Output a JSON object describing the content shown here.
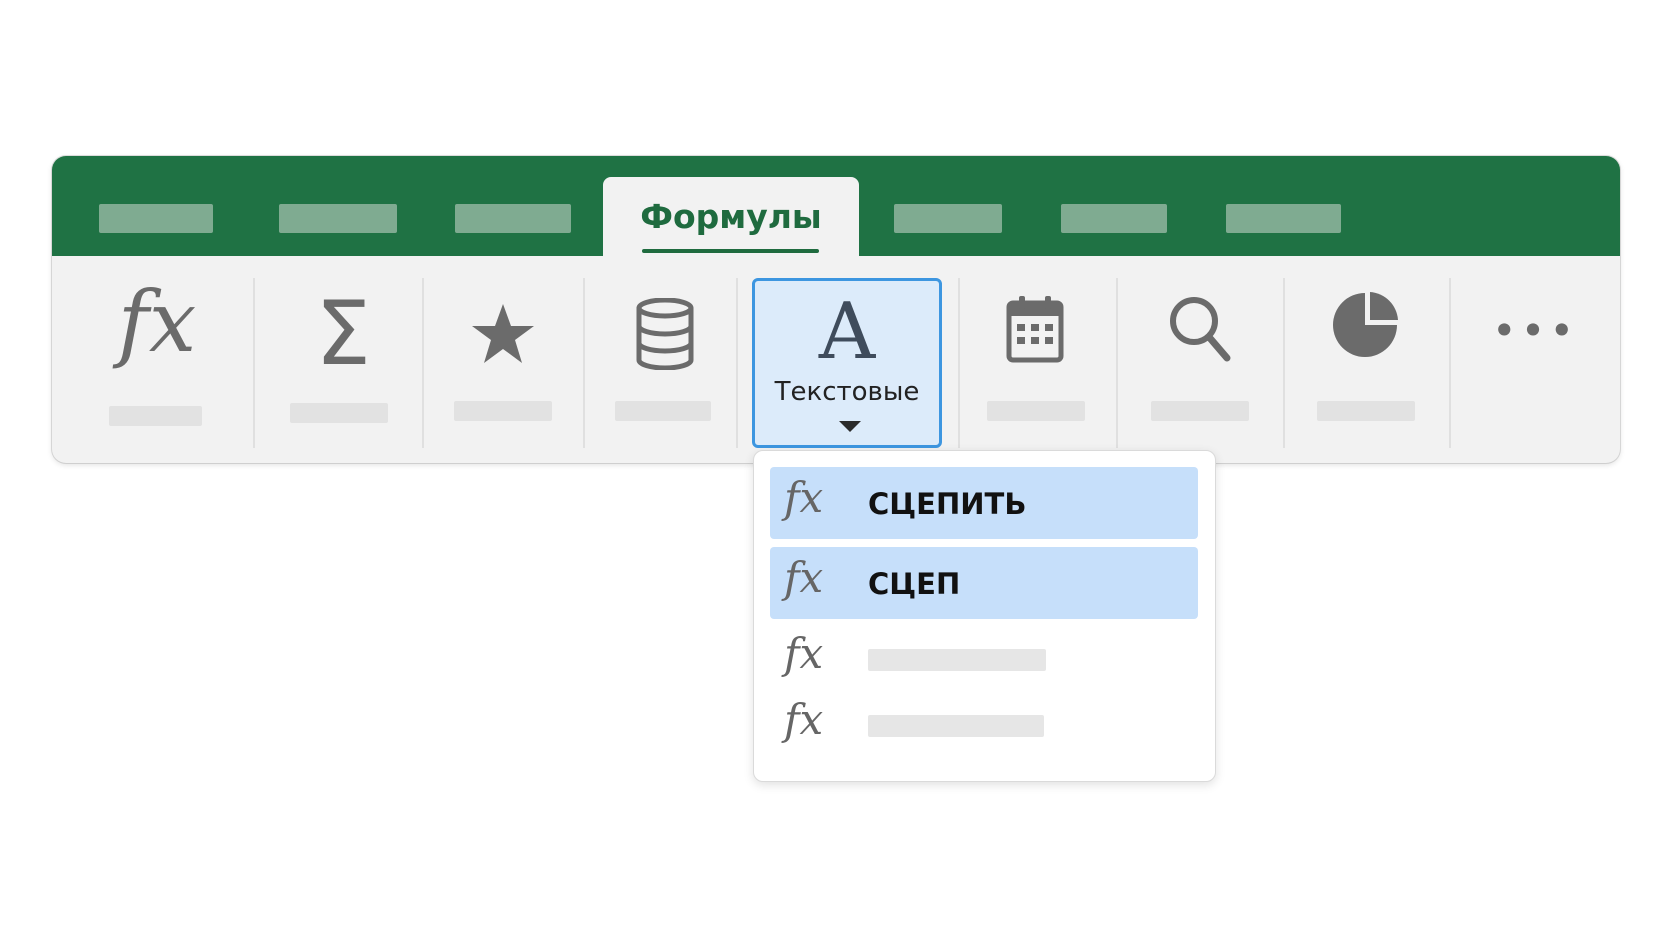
{
  "ribbon": {
    "active_tab": "Формулы",
    "groups": {
      "text": {
        "label": "Текстовые",
        "icon": "letter-a-icon"
      }
    },
    "icons": [
      "fx-icon",
      "sigma-icon",
      "star-icon",
      "database-icon",
      "letter-a-icon",
      "calendar-icon",
      "search-icon",
      "pie-chart-icon",
      "more-icon"
    ]
  },
  "dropdown": {
    "items": [
      {
        "label": "СЦЕПИТЬ",
        "selected": true,
        "icon": "fx-icon"
      },
      {
        "label": "СЦЕП",
        "selected": true,
        "icon": "fx-icon"
      },
      {
        "label": "",
        "selected": false,
        "icon": "fx-icon"
      },
      {
        "label": "",
        "selected": false,
        "icon": "fx-icon"
      }
    ]
  },
  "colors": {
    "ribbon_green": "#1f7244",
    "active_tab_text": "#1f6b3f",
    "selected_item": "#c6dffa",
    "focus_border": "#3d96e0"
  }
}
